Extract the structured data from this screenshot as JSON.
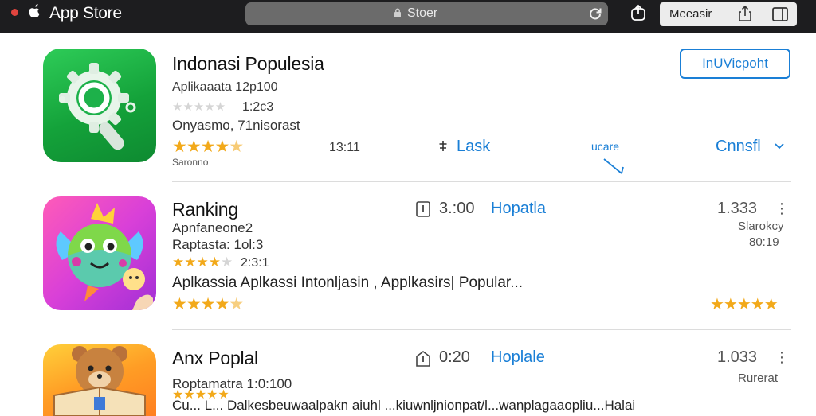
{
  "topbar": {
    "app_title": "App Store",
    "search_text": "Stoer",
    "group_label": "Meeasir"
  },
  "apps": [
    {
      "title": "Indonasi Populesia",
      "subtitle": "Aplikaaata 12p100",
      "rating_count": "1:2c3",
      "developer": "Onyasmo, 71nisorast",
      "rating_value": "13:11",
      "footnote": "Saronno",
      "action_link": "Lask",
      "mid_link": "ucare",
      "more_link": "Cnnsfl",
      "get_label": "InUVicpoht"
    },
    {
      "title": "Ranking",
      "subtitle": "Apnfaneone2",
      "subtitle2": "Raptasta: 1ol:3",
      "rating_count": "2:3:1",
      "description": "Aplkassia Aplkassi  Intonljasin , Applkasirs| Popular...",
      "size": "3.:00",
      "category": "Hopatla",
      "downloads": "1.333",
      "rank_label": "Slarokcy",
      "rank_value": "80:19"
    },
    {
      "title": "Anx Poplal",
      "subtitle": "Roptamatra 1:0:100",
      "description": "Cu... L... Dalkesbeuwaalpakn aiuhl ...kiuwnljnionpat/l...wanplagaaopliu...Halai",
      "size": "0:20",
      "category": "Hoplale",
      "downloads": "1.033",
      "rank_label": "Rurerat"
    }
  ],
  "colors": {
    "accent": "#1a7fd6",
    "star": "#f2a91a",
    "topbar": "#1d1d1f"
  }
}
